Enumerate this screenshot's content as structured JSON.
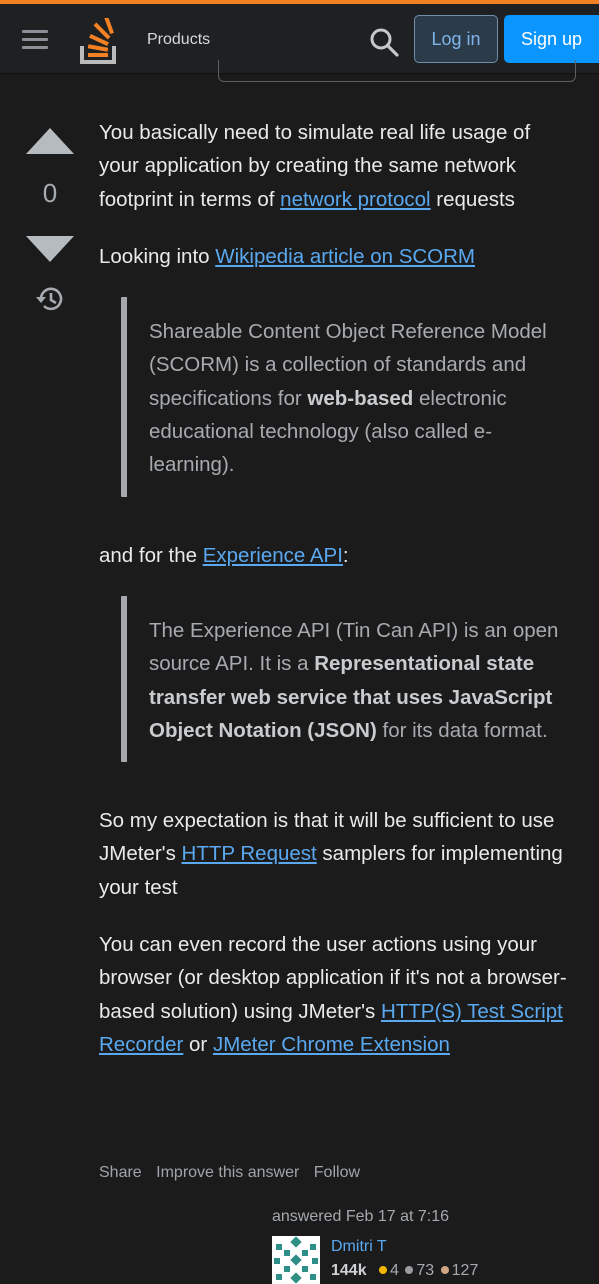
{
  "header": {
    "products_label": "Products",
    "login_label": "Log in",
    "signup_label": "Sign up",
    "accent_color": "#f48024",
    "signup_color": "#0a95ff"
  },
  "vote": {
    "count": "0"
  },
  "post": {
    "p1": {
      "before": "You basically need to simulate real life usage of your application by creating the same network footprint in terms of ",
      "link": "network protocol",
      "after": " requests"
    },
    "p2": {
      "before": "Looking into ",
      "link": "Wikipedia article on SCORM"
    },
    "quote1": {
      "text1": "Shareable Content Object Reference Model (SCORM) is a collection of standards and specifications for ",
      "bold": "web-based",
      "text2": " electronic educational technology (also called e-learning)."
    },
    "p3": {
      "before": "and for the ",
      "link": "Experience API",
      "after": ":"
    },
    "quote2": {
      "text1": "The Experience API (Tin Can API) is an open source API. It is a ",
      "bold": "Representational state transfer web service that uses JavaScript Object Notation (JSON)",
      "text2": " for its data format."
    },
    "p4": {
      "before": "So my expectation is that it will be sufficient to use JMeter's ",
      "link": "HTTP Request",
      "after": " samplers for implementing your test"
    },
    "p5": {
      "before": "You can even record the user actions using your browser (or desktop application if it's not a browser-based solution) using JMeter's ",
      "link1": "HTTP(S) Test Script Recorder",
      "middle": " or ",
      "link2": "JMeter Chrome Extension"
    }
  },
  "actions": {
    "share": "Share",
    "improve": "Improve this answer",
    "follow": "Follow"
  },
  "author": {
    "answered": "answered Feb 17 at 7:16",
    "name": "Dmitri T",
    "reputation": "144k",
    "gold": "4",
    "silver": "73",
    "bronze": "127",
    "gold_color": "#f1b600",
    "silver_color": "#9a9c9f",
    "bronze_color": "#d1a684"
  }
}
